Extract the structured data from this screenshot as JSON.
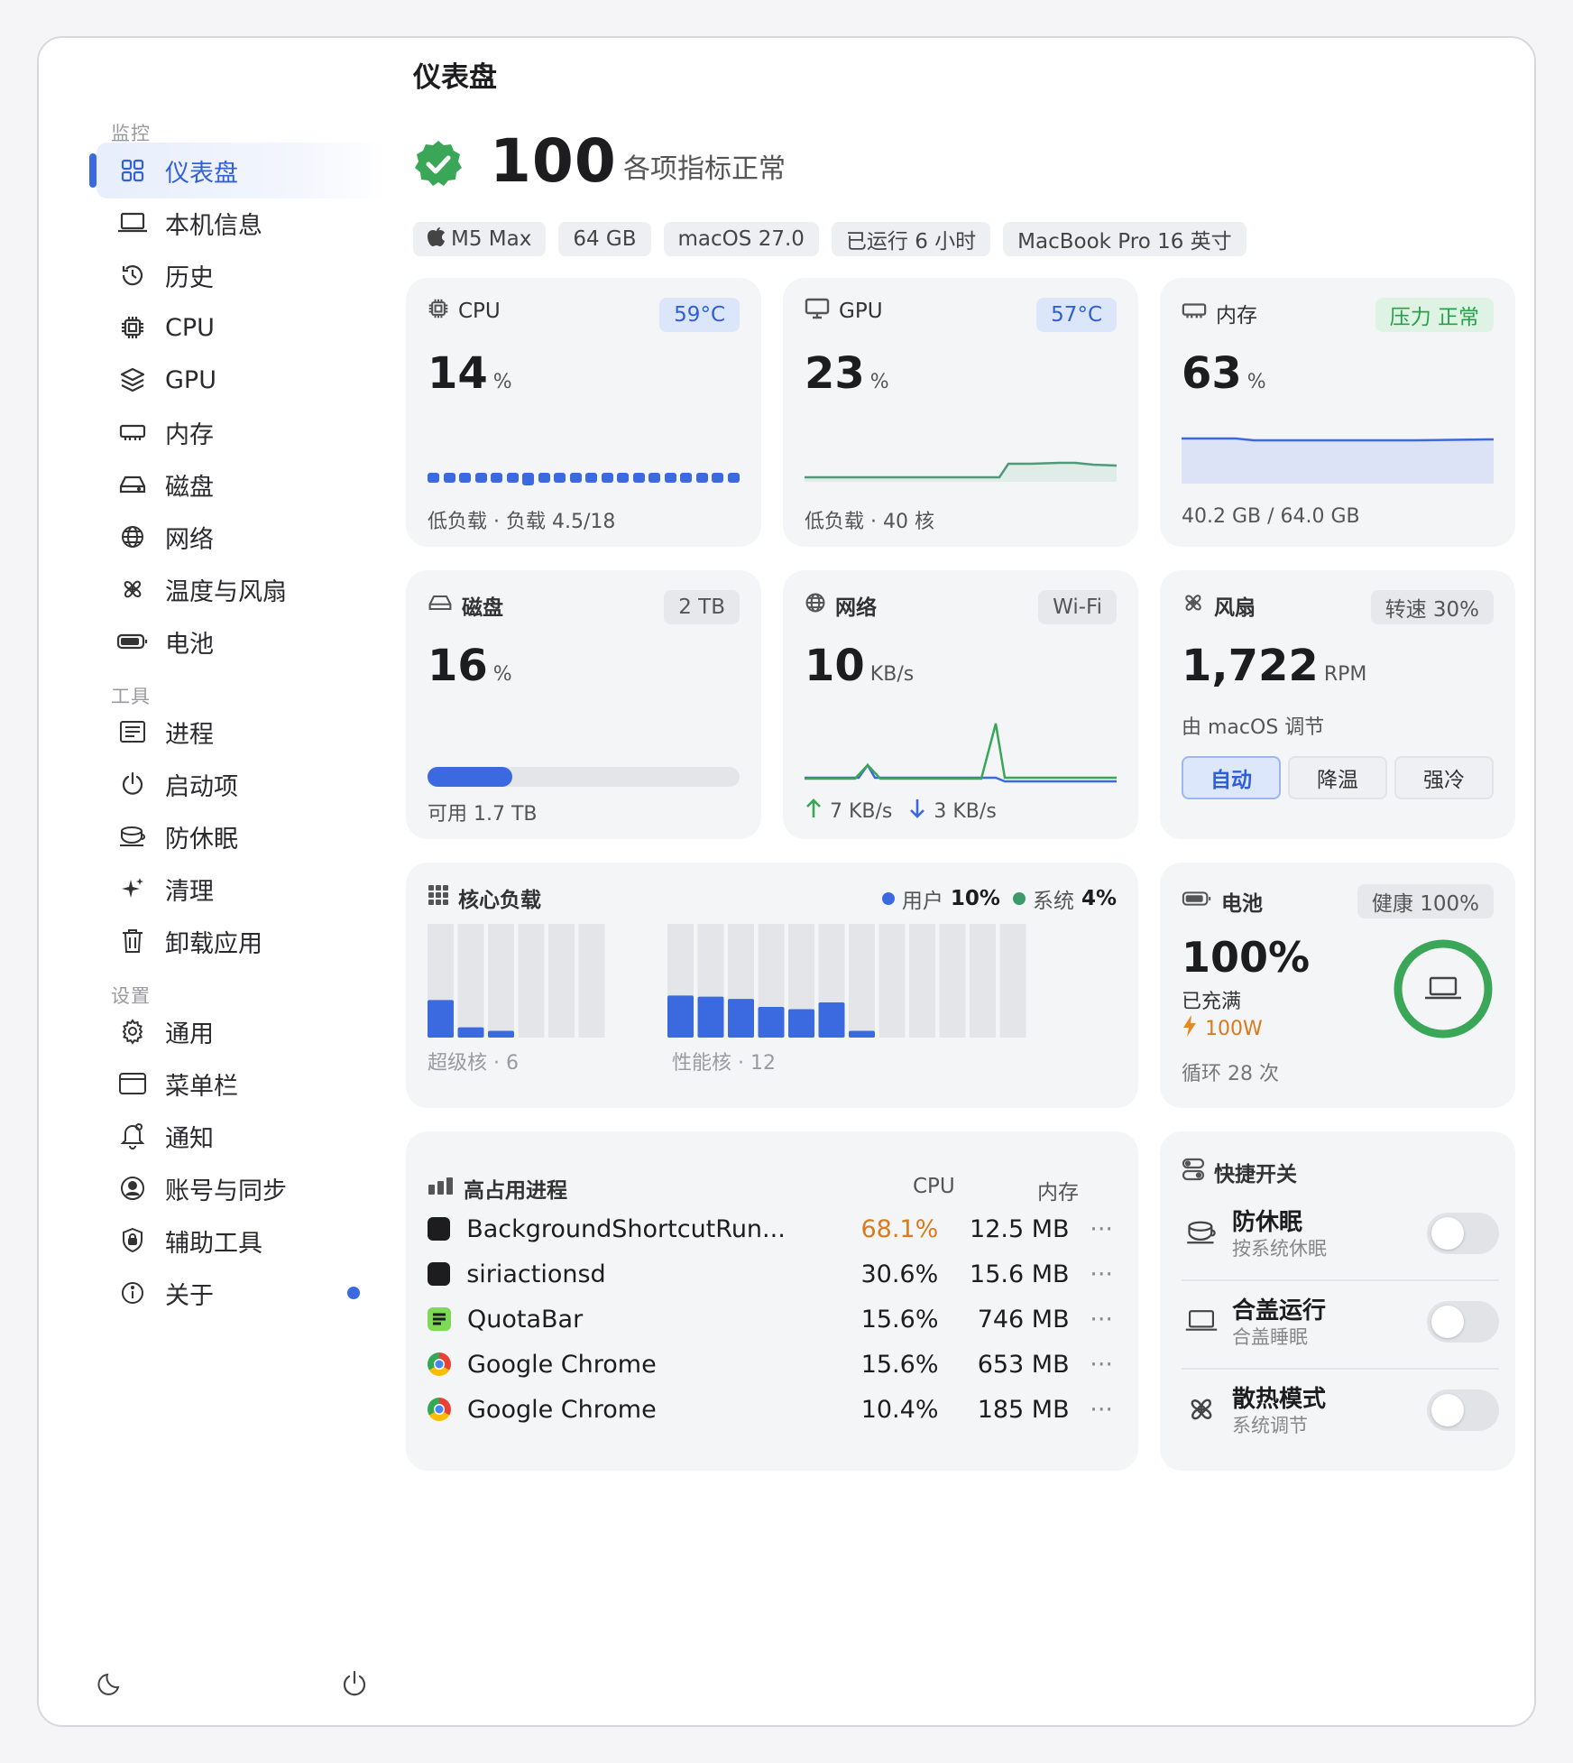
{
  "window": {
    "title": "仪表盘"
  },
  "sidebar": {
    "sections": [
      "监控",
      "工具",
      "设置"
    ],
    "monitor": [
      {
        "label": "仪表盘",
        "icon": "dashboard-grid-icon",
        "active": true
      },
      {
        "label": "本机信息",
        "icon": "laptop-icon"
      },
      {
        "label": "历史",
        "icon": "history-icon"
      },
      {
        "label": "CPU",
        "icon": "cpu-chip-icon"
      },
      {
        "label": "GPU",
        "icon": "layers-icon"
      },
      {
        "label": "内存",
        "icon": "memory-icon"
      },
      {
        "label": "磁盘",
        "icon": "disk-drive-icon"
      },
      {
        "label": "网络",
        "icon": "globe-icon"
      },
      {
        "label": "温度与风扇",
        "icon": "fan-icon"
      },
      {
        "label": "电池",
        "icon": "battery-icon"
      }
    ],
    "tools": [
      {
        "label": "进程",
        "icon": "process-list-icon"
      },
      {
        "label": "启动项",
        "icon": "power-icon"
      },
      {
        "label": "防休眠",
        "icon": "coffee-cup-icon"
      },
      {
        "label": "清理",
        "icon": "sparkle-icon"
      },
      {
        "label": "卸载应用",
        "icon": "trash-icon"
      }
    ],
    "settings": [
      {
        "label": "通用",
        "icon": "gear-icon"
      },
      {
        "label": "菜单栏",
        "icon": "menubar-window-icon"
      },
      {
        "label": "通知",
        "icon": "bell-icon"
      },
      {
        "label": "账号与同步",
        "icon": "account-icon"
      },
      {
        "label": "辅助工具",
        "icon": "shield-lock-icon"
      },
      {
        "label": "关于",
        "icon": "info-icon"
      }
    ]
  },
  "health": {
    "score": "100",
    "text": "各项指标正常"
  },
  "chips": [
    "M5 Max",
    "64 GB",
    "macOS 27.0",
    "已运行 6 小时",
    "MacBook Pro 16 英寸"
  ],
  "cpu": {
    "title": "CPU",
    "badge": "59°C",
    "value": "14",
    "unit": "%",
    "footer": "低负载 · 负载 4.5/18",
    "dots": 20
  },
  "gpu": {
    "title": "GPU",
    "badge": "57°C",
    "value": "23",
    "unit": "%",
    "footer": "低负载 · 40 核"
  },
  "memory": {
    "title": "内存",
    "badge": "压力 正常",
    "value": "63",
    "unit": "%",
    "footer": "40.2 GB / 64.0 GB"
  },
  "disk": {
    "title": "磁盘",
    "badge": "2 TB",
    "value": "16",
    "unit": "%",
    "used_fraction": 0.16,
    "footer": "可用 1.7 TB"
  },
  "network": {
    "title": "网络",
    "badge": "Wi-Fi",
    "value": "10",
    "unit": "KB/s",
    "up": "7 KB/s",
    "down": "3 KB/s"
  },
  "fan": {
    "title": "风扇",
    "badge": "转速 30%",
    "value": "1,722",
    "unit": "RPM",
    "subtitle": "由 macOS 调节",
    "modes": [
      "自动",
      "降温",
      "强冷"
    ],
    "active_mode": 0
  },
  "cores": {
    "title": "核心负载",
    "legend": [
      {
        "label": "用户",
        "value": "10%",
        "color": "#3b6ae0"
      },
      {
        "label": "系统",
        "value": "4%",
        "color": "#3a9a6a"
      }
    ],
    "super_label": "超级核 · 6",
    "perf_label": "性能核 · 12",
    "super_loads": [
      0.33,
      0.09,
      0.06,
      0,
      0,
      0
    ],
    "perf_loads": [
      0.37,
      0.36,
      0.34,
      0.27,
      0.25,
      0.31,
      0.06,
      0,
      0,
      0,
      0,
      0
    ]
  },
  "battery": {
    "title": "电池",
    "badge": "健康 100%",
    "value": "100%",
    "status": "已充满",
    "power": "100W",
    "cycles": "循环 28 次",
    "level": 1.0
  },
  "processes": {
    "title": "高占用进程",
    "col_cpu": "CPU",
    "col_mem": "内存",
    "rows": [
      {
        "name": "BackgroundShortcutRun...",
        "cpu": "68.1%",
        "mem": "12.5 MB",
        "icon_color": "#1d1d1f",
        "hot": true
      },
      {
        "name": "siriactionsd",
        "cpu": "30.6%",
        "mem": "15.6 MB",
        "icon_color": "#1d1d1f",
        "hot": false
      },
      {
        "name": "QuotaBar",
        "cpu": "15.6%",
        "mem": "746 MB",
        "icon_color": "#7ed957",
        "hot": false
      },
      {
        "name": "Google Chrome",
        "cpu": "15.6%",
        "mem": "653 MB",
        "icon_color": "chrome",
        "hot": false
      },
      {
        "name": "Google Chrome",
        "cpu": "10.4%",
        "mem": "185 MB",
        "icon_color": "chrome",
        "hot": false
      }
    ]
  },
  "quick": {
    "title": "快捷开关",
    "items": [
      {
        "title": "防休眠",
        "subtitle": "按系统休眠",
        "icon": "coffee-cup-icon",
        "on": false
      },
      {
        "title": "合盖运行",
        "subtitle": "合盖睡眠",
        "icon": "laptop-icon",
        "on": false
      },
      {
        "title": "散热模式",
        "subtitle": "系统调节",
        "icon": "fan-icon",
        "on": false
      }
    ]
  },
  "colors": {
    "accent": "#3b6ae0",
    "green": "#27a04a",
    "orange": "#d97a1c"
  }
}
